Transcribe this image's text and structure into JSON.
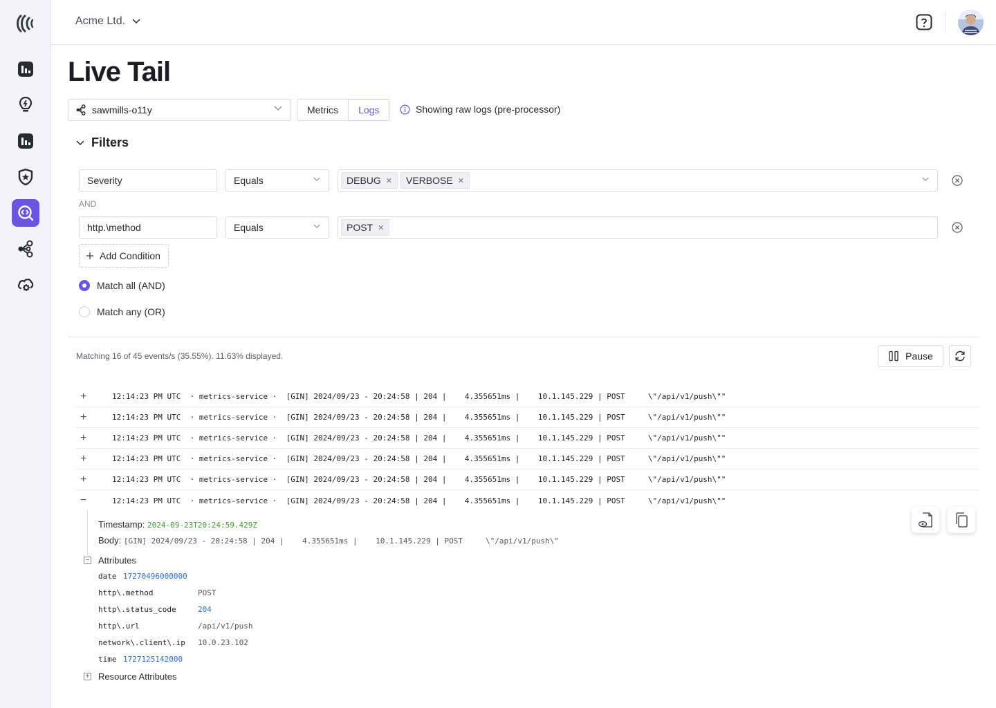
{
  "topbar": {
    "org_name": "Acme Ltd."
  },
  "sidebar": {
    "items": [
      {
        "icon": "dashboard-chart-icon"
      },
      {
        "icon": "lightbulb-icon"
      },
      {
        "icon": "analytics-chart-icon"
      },
      {
        "icon": "shield-star-icon"
      },
      {
        "icon": "live-tail-search-icon",
        "active": true
      },
      {
        "icon": "pipeline-nodes-icon"
      },
      {
        "icon": "cloud-settings-icon"
      }
    ]
  },
  "page": {
    "title": "Live Tail"
  },
  "controls": {
    "pipeline": "sawmills-o11y",
    "tab_metrics": "Metrics",
    "tab_logs": "Logs",
    "info_text": "Showing raw logs (pre-processor)"
  },
  "filters": {
    "heading": "Filters",
    "and_label": "AND",
    "rows": [
      {
        "field": "Severity",
        "operator": "Equals",
        "values": [
          "DEBUG",
          "VERBOSE"
        ]
      },
      {
        "field": "http.\\method",
        "operator": "Equals",
        "values": [
          "POST"
        ]
      }
    ],
    "add_condition": "Add Condition",
    "match_all": "Match all (AND)",
    "match_any": "Match any (OR)",
    "selected_match": "all"
  },
  "stream": {
    "matching_text": "Matching 16 of 45 events/s (35.55%). 11.63% displayed.",
    "pause_label": "Pause",
    "rows": [
      "12:14:23 PM UTC  · metrics-service ·  [GIN] 2024/09/23 - 20:24:58 | 204 |    4.355651ms |    10.1.145.229 | POST     \\\"/api/v1/push\\\"\"",
      "12:14:23 PM UTC  · metrics-service ·  [GIN] 2024/09/23 - 20:24:58 | 204 |    4.355651ms |    10.1.145.229 | POST     \\\"/api/v1/push\\\"\"",
      "12:14:23 PM UTC  · metrics-service ·  [GIN] 2024/09/23 - 20:24:58 | 204 |    4.355651ms |    10.1.145.229 | POST     \\\"/api/v1/push\\\"\"",
      "12:14:23 PM UTC  · metrics-service ·  [GIN] 2024/09/23 - 20:24:58 | 204 |    4.355651ms |    10.1.145.229 | POST     \\\"/api/v1/push\\\"\"",
      "12:14:23 PM UTC  · metrics-service ·  [GIN] 2024/09/23 - 20:24:58 | 204 |    4.355651ms |    10.1.145.229 | POST     \\\"/api/v1/push\\\"\"",
      "12:14:23 PM UTC  · metrics-service ·  [GIN] 2024/09/23 - 20:24:58 | 204 |    4.355651ms |    10.1.145.229 | POST     \\\"/api/v1/push\\\"\""
    ],
    "expanded_index": 5
  },
  "detail": {
    "timestamp_label": "Timestamp:",
    "timestamp_value": "2024-09-23T20:24:59.429Z",
    "body_label": "Body:",
    "body_value": "[GIN] 2024/09/23 - 20:24:58 | 204 |    4.355651ms |    10.1.145.229 | POST     \\\"/api/v1/push\\\"",
    "attributes_label": "Attributes",
    "attributes": [
      {
        "key": "date",
        "value": "17270496000000",
        "kind": "number"
      },
      {
        "key": "http\\.method",
        "value": "POST",
        "kind": "string"
      },
      {
        "key": "http\\.status_code",
        "value": "204",
        "kind": "number"
      },
      {
        "key": "http\\.url",
        "value": "/api/v1/push",
        "kind": "string"
      },
      {
        "key": "network\\.client\\.ip",
        "value": "10.0.23.102",
        "kind": "string"
      },
      {
        "key": "time",
        "value": "1727125142000",
        "kind": "number"
      }
    ],
    "resource_label": "Resource Attributes"
  },
  "colors": {
    "accent": "#6b55e0",
    "number": "#2d6fd6",
    "timestamp": "#3d9b2f"
  }
}
